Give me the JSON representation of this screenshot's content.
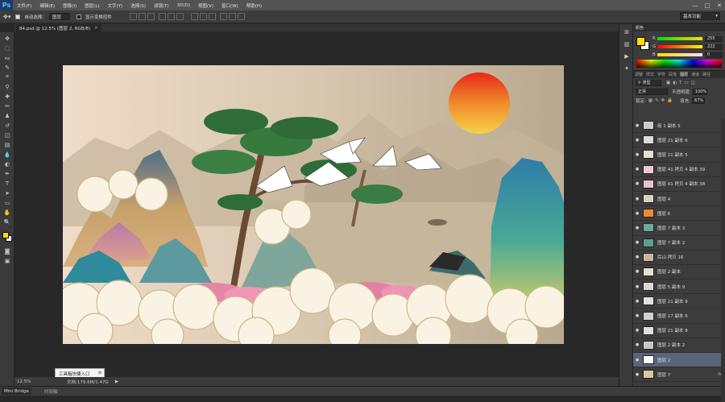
{
  "app": {
    "logo": "Ps",
    "menu": [
      "文件(F)",
      "编辑(E)",
      "图像(I)",
      "图层(L)",
      "文字(Y)",
      "选择(S)",
      "滤镜(T)",
      "3D(D)",
      "视图(V)",
      "窗口(W)",
      "帮助(H)"
    ],
    "window_controls": [
      "—",
      "□",
      "✕"
    ]
  },
  "options_bar": {
    "auto_select_label": "自动选择：",
    "auto_select_value": "图层",
    "show_transform_label": "显示变换控件",
    "workspace": "基本功能"
  },
  "document": {
    "tab_label": "84.psd @ 12.5% (图层 2, RGB/8)",
    "tab_close": "×"
  },
  "status": {
    "zoom": "12.5%",
    "doc_info": "文档:179.6M/1.47G",
    "arrow": "▶"
  },
  "tooltip": {
    "text": "工具箱快捷入口",
    "close": "✕"
  },
  "bottom": {
    "mini_bridge": "Mini Bridge",
    "timeline": "时间轴"
  },
  "color_panel": {
    "title": "颜色",
    "r_label": "R",
    "r_value": "255",
    "g_label": "G",
    "g_value": "222",
    "b_label": "B",
    "b_value": "0",
    "fg_color": "#ffde00",
    "bg_color": "#ffffff"
  },
  "layers_panel": {
    "tabs": [
      "调整",
      "样式",
      "字符",
      "段落",
      "图层",
      "通道",
      "路径"
    ],
    "kind_label": "类型",
    "blend_mode": "正常",
    "opacity_label": "不透明度:",
    "opacity_value": "100%",
    "lock_label": "锁定:",
    "fill_label": "填充:",
    "fill_value": "67%",
    "layers": [
      {
        "name": "组 1 副本 5",
        "fx": ""
      },
      {
        "name": "图层 21 副本 6",
        "fx": ""
      },
      {
        "name": "图层 21 副本 5",
        "fx": ""
      },
      {
        "name": "图层 41 拷贝 4 副本 39",
        "fx": ""
      },
      {
        "name": "图层 41 拷贝 4 副本 38",
        "fx": ""
      },
      {
        "name": "图层 4",
        "fx": ""
      },
      {
        "name": "图层 6",
        "fx": ""
      },
      {
        "name": "图层 7 副本 3",
        "fx": ""
      },
      {
        "name": "图层 7 副本 2",
        "fx": ""
      },
      {
        "name": "后山 拷贝 16",
        "fx": ""
      },
      {
        "name": "图层 2 副本",
        "fx": ""
      },
      {
        "name": "图层 5 副本 9",
        "fx": ""
      },
      {
        "name": "图层 21 副本 9",
        "fx": ""
      },
      {
        "name": "图层 17 副本 6",
        "fx": ""
      },
      {
        "name": "图层 21 副本 8",
        "fx": ""
      },
      {
        "name": "图层 2 副本 2",
        "fx": ""
      },
      {
        "name": "图层 2",
        "fx": "",
        "selected": true
      },
      {
        "name": "图层 7",
        "fx": "fx"
      }
    ]
  }
}
